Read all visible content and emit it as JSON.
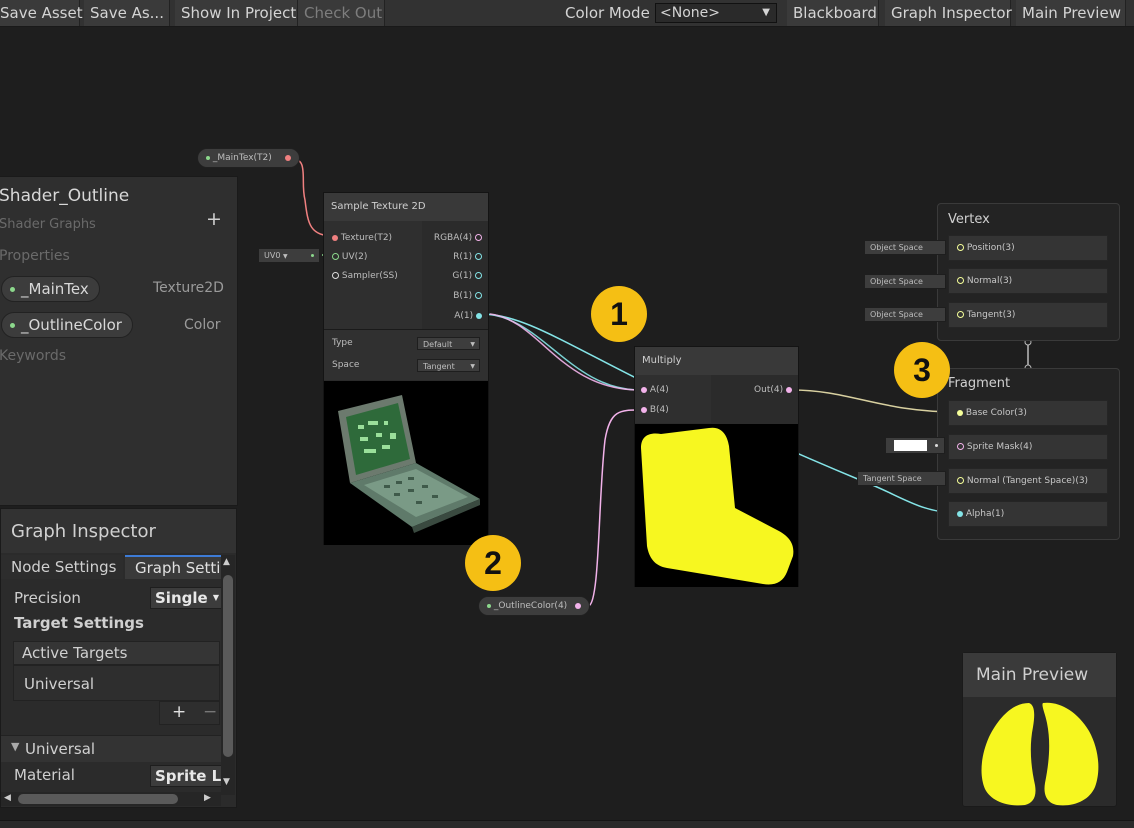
{
  "toolbar": {
    "save_asset": "Save Asset",
    "save_as": "Save As...",
    "show_in_project": "Show In Project",
    "check_out": "Check Out",
    "color_mode_label": "Color Mode",
    "color_mode_value": "<None>",
    "blackboard": "Blackboard",
    "graph_inspector": "Graph Inspector",
    "main_preview": "Main Preview"
  },
  "blackboard": {
    "title": "Shader_Outline",
    "subtitle": "Shader Graphs",
    "add": "+",
    "properties_header": "Properties",
    "properties": [
      {
        "name": "_MainTex",
        "type": "Texture2D"
      },
      {
        "name": "_OutlineColor",
        "type": "Color"
      }
    ],
    "keywords_header": "Keywords"
  },
  "graph_inspector": {
    "title": "Graph Inspector",
    "tabs": [
      "Node Settings",
      "Graph Settir"
    ],
    "precision_label": "Precision",
    "precision_value": "Single",
    "target_settings": "Target Settings",
    "active_targets": "Active Targets",
    "targets": [
      "Universal"
    ],
    "add": "+",
    "remove": "−",
    "universal_section": "Universal",
    "material_label": "Material",
    "material_value": "Sprite Li"
  },
  "nodes": {
    "maintex_prop": "_MainTex(T2)",
    "sample_texture": {
      "title": "Sample Texture 2D",
      "inputs": [
        "Texture(T2)",
        "UV(2)",
        "Sampler(SS)"
      ],
      "outputs": [
        "RGBA(4)",
        "R(1)",
        "G(1)",
        "B(1)",
        "A(1)"
      ],
      "uv_value": "UV0",
      "type_label": "Type",
      "type_value": "Default",
      "space_label": "Space",
      "space_value": "Tangent"
    },
    "multiply": {
      "title": "Multiply",
      "inputs": [
        "A(4)",
        "B(4)"
      ],
      "output": "Out(4)"
    },
    "outline_color_prop": "_OutlineColor(4)",
    "vertex": {
      "title": "Vertex",
      "slots": [
        "Position(3)",
        "Normal(3)",
        "Tangent(3)"
      ],
      "space_fields": [
        "Object Space",
        "Object Space",
        "Object Space"
      ]
    },
    "fragment": {
      "title": "Fragment",
      "slots": [
        "Base Color(3)",
        "Sprite Mask(4)",
        "Normal (Tangent Space)(3)",
        "Alpha(1)"
      ],
      "normal_space": "Tangent Space"
    }
  },
  "badges": [
    "1",
    "2",
    "3"
  ],
  "main_preview": {
    "title": "Main Preview"
  },
  "colors": {
    "texture_port": "#f08080",
    "vector2_port": "#8cd88c",
    "vector4_port": "#f2b2ea",
    "vector1_port": "#84e4e7",
    "vector3_port": "#f6ff9a",
    "badge": "#f5bf14",
    "preview_yellow": "#f7f720"
  }
}
